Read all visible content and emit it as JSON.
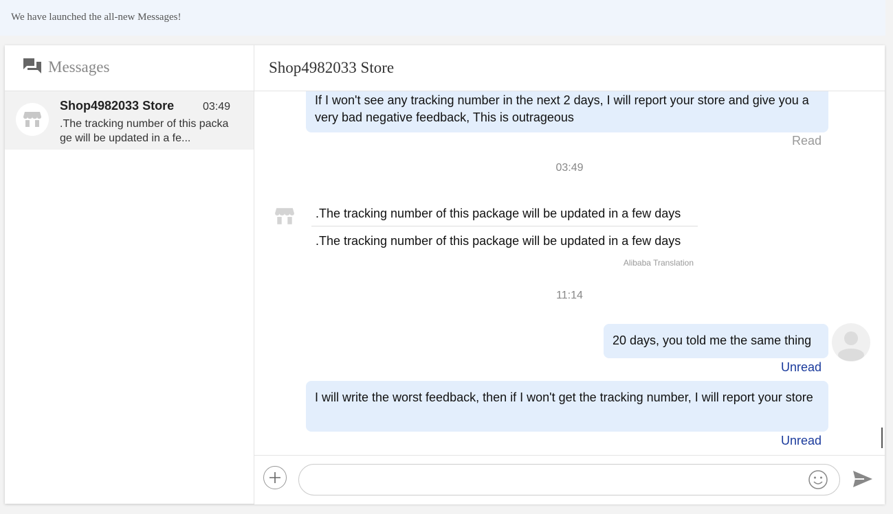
{
  "banner": {
    "text": "We have launched the all-new Messages!"
  },
  "sidebar": {
    "title": "Messages",
    "conversations": [
      {
        "name": "Shop4982033 Store",
        "time": "03:49",
        "preview": ".The tracking number of this package will be updated in a fe..."
      }
    ]
  },
  "chat": {
    "title": "Shop4982033 Store",
    "messages": {
      "m1": {
        "text": "If I won't see any tracking number in the next 2 days, I will report your store and give you a very bad negative feedback, This is outrageous",
        "status": "Read"
      },
      "stamp1": "03:49",
      "m2": {
        "original": ".The tracking number of this package will be updated in a few days",
        "translated": ".The tracking number of this package will be updated in a few days",
        "credit": "Alibaba Translation"
      },
      "stamp2": "11:14",
      "m3": {
        "text": "20 days, you told me the same thing",
        "status": "Unread"
      },
      "m4": {
        "text": "I will write the worst feedback, then if I won't get the tracking number, I will report your store",
        "status": "Unread"
      }
    },
    "input": {
      "value": "",
      "placeholder": ""
    }
  },
  "colors": {
    "bubble": "#e3eefc",
    "unread": "#1a3a9c",
    "banner_bg": "#f0f5fc"
  },
  "icons": [
    "messages-icon",
    "store-icon",
    "user-avatar-icon",
    "plus-icon",
    "emoji-icon",
    "send-icon"
  ]
}
